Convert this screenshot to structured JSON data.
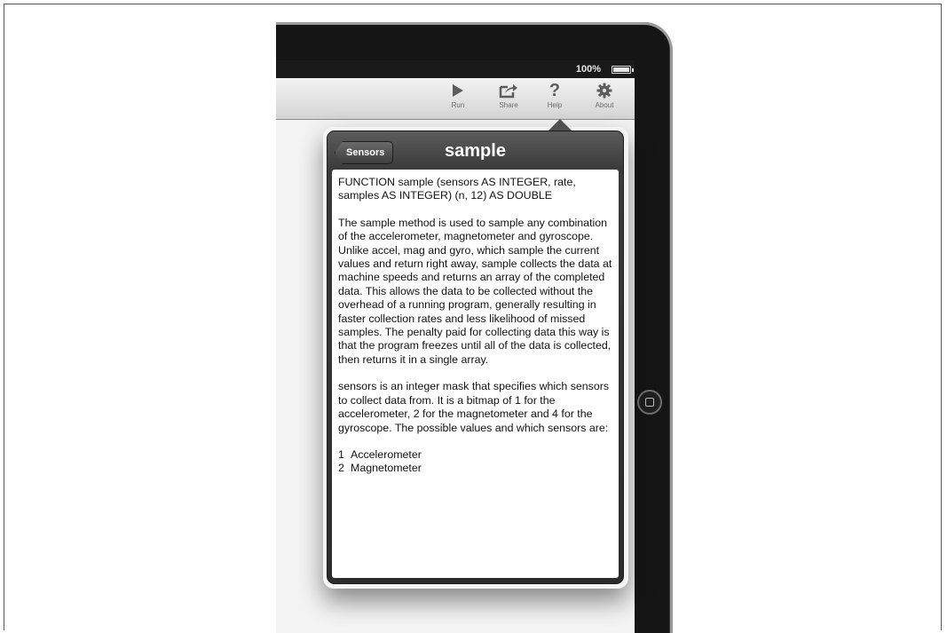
{
  "status_bar": {
    "battery": "100%"
  },
  "toolbar": {
    "items": [
      {
        "label": "Run",
        "icon": "play-icon"
      },
      {
        "label": "Share",
        "icon": "share-icon"
      },
      {
        "label": "Help",
        "icon": "question-icon"
      },
      {
        "label": "About",
        "icon": "gear-icon"
      }
    ]
  },
  "popover": {
    "back_label": "Sensors",
    "title": "sample",
    "paragraphs": [
      "FUNCTION sample (sensors AS INTEGER, rate, samples AS INTEGER) (n, 12) AS DOUBLE",
      "The sample method is used to sample any combination of the accelerometer, magnetometer and gyroscope. Unlike accel, mag and gyro, which sample the current values and return right away, sample collects the data at machine speeds and returns an array of the completed data. This allows the data to be collected without the overhead of a running program, generally resulting in faster collection rates and less likelihood of missed samples. The penalty paid for collecting data this way is that the program freezes until all of the data is collected, then returns it in a single array.",
      "sensors is an integer mask that specifies which sensors to collect data from. It is a bitmap of 1 for the accelerometer, 2 for the magnetometer and 4 for the gyroscope. The possible values and which sensors are:"
    ],
    "list": [
      {
        "num": "1",
        "text": "Accelerometer"
      },
      {
        "num": "2",
        "text": "Magnetometer"
      }
    ]
  }
}
